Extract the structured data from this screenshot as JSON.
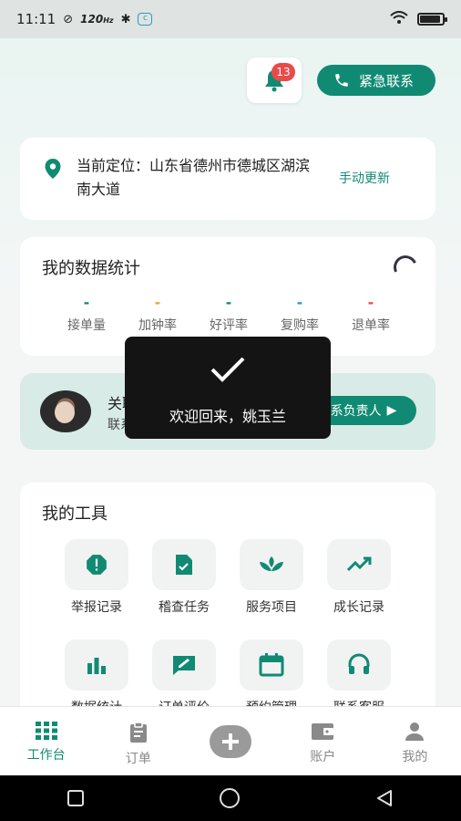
{
  "status_bar": {
    "time": "11:11",
    "net_speed": "120",
    "net_unit": "Hz"
  },
  "header": {
    "notification_count": "13",
    "emergency_label": "紧急联系"
  },
  "location": {
    "text": "当前定位：山东省德州市德城区湖滨南大道",
    "refresh_label": "手动更新"
  },
  "stats": {
    "title": "我的数据统计",
    "items": [
      {
        "value": "-",
        "label": "接单量",
        "color": "#118a73"
      },
      {
        "value": "-",
        "label": "加钟率",
        "color": "#f0a030"
      },
      {
        "value": "-",
        "label": "好评率",
        "color": "#118a73"
      },
      {
        "value": "-",
        "label": "复购率",
        "color": "#2a9ac0"
      },
      {
        "value": "-",
        "label": "退单率",
        "color": "#e94b4b"
      }
    ]
  },
  "manager": {
    "name_label": "关联的负责人",
    "contact_label": "联系方式",
    "button_label": "联系负责人"
  },
  "tools": {
    "title": "我的工具",
    "items": [
      {
        "label": "举报记录",
        "icon": "alert-octagon-icon"
      },
      {
        "label": "稽查任务",
        "icon": "file-check-icon"
      },
      {
        "label": "服务项目",
        "icon": "lotus-icon"
      },
      {
        "label": "成长记录",
        "icon": "trending-up-icon"
      },
      {
        "label": "数据统计",
        "icon": "bar-chart-icon"
      },
      {
        "label": "订单评价",
        "icon": "review-edit-icon"
      },
      {
        "label": "预约管理",
        "icon": "calendar-icon"
      },
      {
        "label": "联系客服",
        "icon": "headset-icon"
      }
    ]
  },
  "toast": {
    "message": "欢迎回来，姚玉兰"
  },
  "tabbar": {
    "items": [
      {
        "label": "工作台",
        "active": true
      },
      {
        "label": "订单",
        "active": false
      },
      {
        "label": "",
        "active": false
      },
      {
        "label": "账户",
        "active": false
      },
      {
        "label": "我的",
        "active": false
      }
    ]
  },
  "colors": {
    "accent": "#118a73",
    "badge": "#e94b4b"
  }
}
